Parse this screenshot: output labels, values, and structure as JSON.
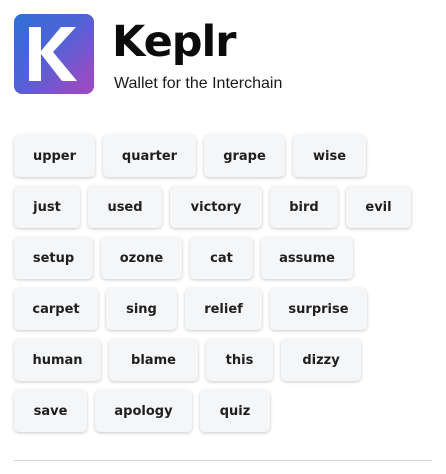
{
  "brand": {
    "name": "Keplr",
    "tagline": "Wallet for the Interchain",
    "logo_letter": "K"
  },
  "mnemonic": {
    "rows": [
      [
        "upper",
        "quarter",
        "grape",
        "wise"
      ],
      [
        "just",
        "used",
        "victory",
        "bird",
        "evil"
      ],
      [
        "setup",
        "ozone",
        "cat",
        "assume"
      ],
      [
        "carpet",
        "sing",
        "relief",
        "surprise"
      ],
      [
        "human",
        "blame",
        "this",
        "dizzy"
      ],
      [
        "save",
        "apology",
        "quiz"
      ]
    ]
  },
  "colors": {
    "chip_background": "#f4f6f8",
    "logo_gradient_start": "#2f6fd6",
    "logo_gradient_end": "#a149c2"
  }
}
